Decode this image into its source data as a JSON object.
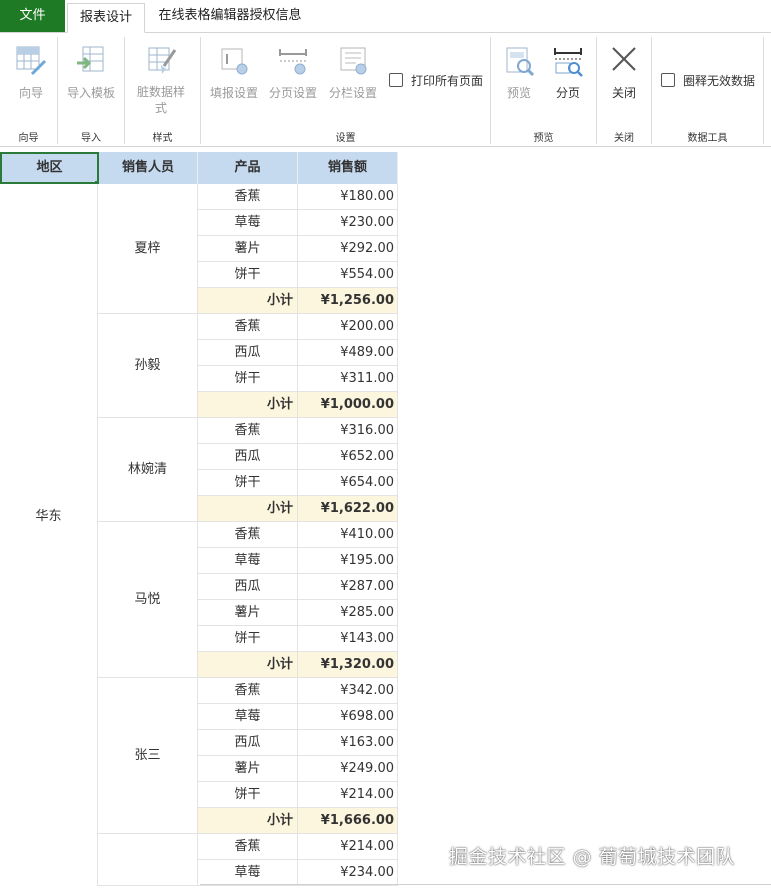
{
  "tabs": {
    "file": "文件",
    "design": "报表设计",
    "license": "在线表格编辑器授权信息"
  },
  "ribbon": {
    "wizard": "向导",
    "import_template": "导入模板",
    "dirty_style": "脏数据样式",
    "fill_settings": "填报设置",
    "page_settings": "分页设置",
    "column_settings": "分栏设置",
    "print_all": "打印所有页面",
    "preview": "预览",
    "paging": "分页",
    "close": "关闭",
    "circle_invalid": "圈释无效数据",
    "groups": {
      "wizard": "向导",
      "import": "导入",
      "style": "样式",
      "settings": "设置",
      "preview": "预览",
      "close": "关闭",
      "data_tools": "数据工具"
    }
  },
  "table": {
    "headers": [
      "地区",
      "销售人员",
      "产品",
      "销售额"
    ],
    "region": "华东",
    "subtotal_label": "小计",
    "groups": [
      {
        "person": "夏梓",
        "rows": [
          [
            "香蕉",
            "¥180.00"
          ],
          [
            "草莓",
            "¥230.00"
          ],
          [
            "薯片",
            "¥292.00"
          ],
          [
            "饼干",
            "¥554.00"
          ]
        ],
        "subtotal": "¥1,256.00"
      },
      {
        "person": "孙毅",
        "rows": [
          [
            "香蕉",
            "¥200.00"
          ],
          [
            "西瓜",
            "¥489.00"
          ],
          [
            "饼干",
            "¥311.00"
          ]
        ],
        "subtotal": "¥1,000.00"
      },
      {
        "person": "林婉清",
        "rows": [
          [
            "香蕉",
            "¥316.00"
          ],
          [
            "西瓜",
            "¥652.00"
          ],
          [
            "饼干",
            "¥654.00"
          ]
        ],
        "subtotal": "¥1,622.00"
      },
      {
        "person": "马悦",
        "rows": [
          [
            "香蕉",
            "¥410.00"
          ],
          [
            "草莓",
            "¥195.00"
          ],
          [
            "西瓜",
            "¥287.00"
          ],
          [
            "薯片",
            "¥285.00"
          ],
          [
            "饼干",
            "¥143.00"
          ]
        ],
        "subtotal": "¥1,320.00"
      },
      {
        "person": "张三",
        "rows": [
          [
            "香蕉",
            "¥342.00"
          ],
          [
            "草莓",
            "¥698.00"
          ],
          [
            "西瓜",
            "¥163.00"
          ],
          [
            "薯片",
            "¥249.00"
          ],
          [
            "饼干",
            "¥214.00"
          ]
        ],
        "subtotal": "¥1,666.00"
      },
      {
        "person": "",
        "rows": [
          [
            "香蕉",
            "¥214.00"
          ],
          [
            "草莓",
            "¥234.00"
          ]
        ],
        "subtotal": null
      }
    ]
  },
  "watermark": "掘金技术社区 @ 葡萄城技术团队",
  "colors": {
    "file_tab": "#1e7a24",
    "header_bg": "#c5d9ef",
    "subtotal_bg": "#fdf6df",
    "selection": "#2a7a3a"
  }
}
